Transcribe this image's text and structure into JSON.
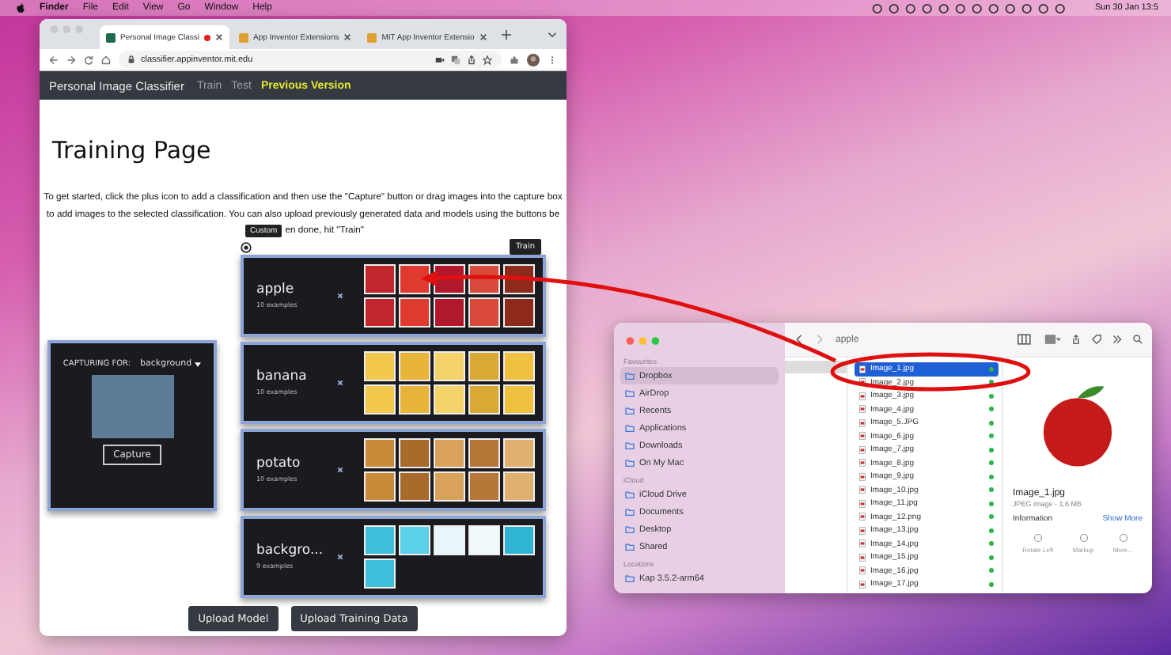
{
  "menu_bar": {
    "app_name": "Finder",
    "menus": [
      "File",
      "Edit",
      "View",
      "Go",
      "Window",
      "Help"
    ],
    "clock": "Sun 30 Jan 13:5"
  },
  "browser": {
    "tabs": [
      {
        "title": "Personal Image Classi",
        "selected": true
      },
      {
        "title": "App Inventor Extensions",
        "selected": false
      },
      {
        "title": "MIT App Inventor Extensio",
        "selected": false
      }
    ],
    "url": "classifier.appinventor.mit.edu"
  },
  "site": {
    "brand": "Personal Image Classifier",
    "nav": [
      {
        "label": "Train",
        "highlighted": false
      },
      {
        "label": "Test",
        "highlighted": false
      },
      {
        "label": "Previous Version",
        "highlighted": true
      }
    ],
    "heading": "Training Page",
    "instructions_before": "To get started, click the plus icon to add a classification and then use the \"Capture\" button or drag images into the capture box to add images to the selected classification. You can also upload previously generated data and models using the buttons be",
    "tooltip": "Custom",
    "instructions_after": "en done, hit \"Train\"",
    "train_button": "Train",
    "capture": {
      "label": "CAPTURING FOR:",
      "target": "background",
      "button": "Capture"
    },
    "classes": [
      {
        "name": "apple",
        "examples": "10 examples",
        "thumbnails": [
          {
            "kind": "photo"
          },
          {
            "kind": "photo"
          },
          {
            "kind": "photo"
          },
          {
            "kind": "photo"
          },
          {
            "kind": "photo"
          },
          {
            "kind": "photo"
          },
          {
            "kind": "photo"
          },
          {
            "kind": "photo"
          },
          {
            "kind": "photo"
          },
          {
            "kind": "photo"
          }
        ]
      },
      {
        "name": "banana",
        "examples": "10 examples",
        "thumbnails": [
          {
            "kind": "photo"
          },
          {
            "kind": "photo"
          },
          {
            "kind": "photo"
          },
          {
            "kind": "photo"
          },
          {
            "kind": "photo"
          },
          {
            "kind": "photo"
          },
          {
            "kind": "photo"
          },
          {
            "kind": "photo"
          },
          {
            "kind": "photo"
          },
          {
            "kind": "photo"
          }
        ]
      },
      {
        "name": "potato",
        "examples": "10 examples",
        "thumbnails": [
          {
            "kind": "photo"
          },
          {
            "kind": "photo"
          },
          {
            "kind": "photo"
          },
          {
            "kind": "photo"
          },
          {
            "kind": "photo"
          },
          {
            "kind": "photo"
          },
          {
            "kind": "photo"
          },
          {
            "kind": "photo"
          },
          {
            "kind": "photo"
          },
          {
            "kind": "photo"
          }
        ]
      },
      {
        "name": "backgro...",
        "examples": "9 examples",
        "thumbnails": [
          {
            "kind": "photo"
          },
          {
            "kind": "photo"
          },
          {
            "kind": "photo"
          },
          {
            "kind": "photo"
          },
          {
            "kind": "photo"
          },
          {
            "kind": "photo"
          }
        ]
      }
    ],
    "buttons": [
      "Upload Model",
      "Upload Training Data"
    ]
  },
  "finder": {
    "folder": "apple",
    "sidebar": [
      {
        "heading": "Favourites",
        "items": [
          {
            "label": "Dropbox",
            "selected": true
          },
          {
            "label": "AirDrop",
            "selected": false
          },
          {
            "label": "Recents",
            "selected": false
          },
          {
            "label": "Applications",
            "selected": false
          },
          {
            "label": "Downloads",
            "selected": false
          },
          {
            "label": "On My Mac",
            "selected": false
          }
        ]
      },
      {
        "heading": "iCloud",
        "items": [
          {
            "label": "iCloud Drive",
            "selected": false
          },
          {
            "label": "Documents",
            "selected": false
          },
          {
            "label": "Desktop",
            "selected": false
          },
          {
            "label": "Shared",
            "selected": false
          }
        ]
      },
      {
        "heading": "Locations",
        "items": [
          {
            "label": "Kap 3.5.2-arm64",
            "selected": false
          }
        ]
      }
    ],
    "files": [
      {
        "name": "Image_1.jpg",
        "selected": true
      },
      {
        "name": "Image_2.jpg",
        "selected": false
      },
      {
        "name": "Image_3.jpg",
        "selected": false
      },
      {
        "name": "Image_4.jpg",
        "selected": false
      },
      {
        "name": "Image_5.JPG",
        "selected": false
      },
      {
        "name": "Image_6.jpg",
        "selected": false
      },
      {
        "name": "Image_7.jpg",
        "selected": false
      },
      {
        "name": "Image_8.jpg",
        "selected": false
      },
      {
        "name": "Image_9.jpg",
        "selected": false
      },
      {
        "name": "Image_10.jpg",
        "selected": false
      },
      {
        "name": "Image_11.jpg",
        "selected": false
      },
      {
        "name": "Image_12.png",
        "selected": false
      },
      {
        "name": "Image_13.jpg",
        "selected": false
      },
      {
        "name": "Image_14.jpg",
        "selected": false
      },
      {
        "name": "Image_15.jpg",
        "selected": false
      },
      {
        "name": "Image_16.jpg",
        "selected": false
      },
      {
        "name": "Image_17.jpg",
        "selected": false
      }
    ],
    "preview": {
      "name": "Image_1.jpg",
      "meta": "JPEG image - 1,6 MB",
      "section": "Information",
      "more_link": "Show More",
      "actions": [
        "Rotate Left",
        "Markup",
        "More..."
      ]
    }
  }
}
